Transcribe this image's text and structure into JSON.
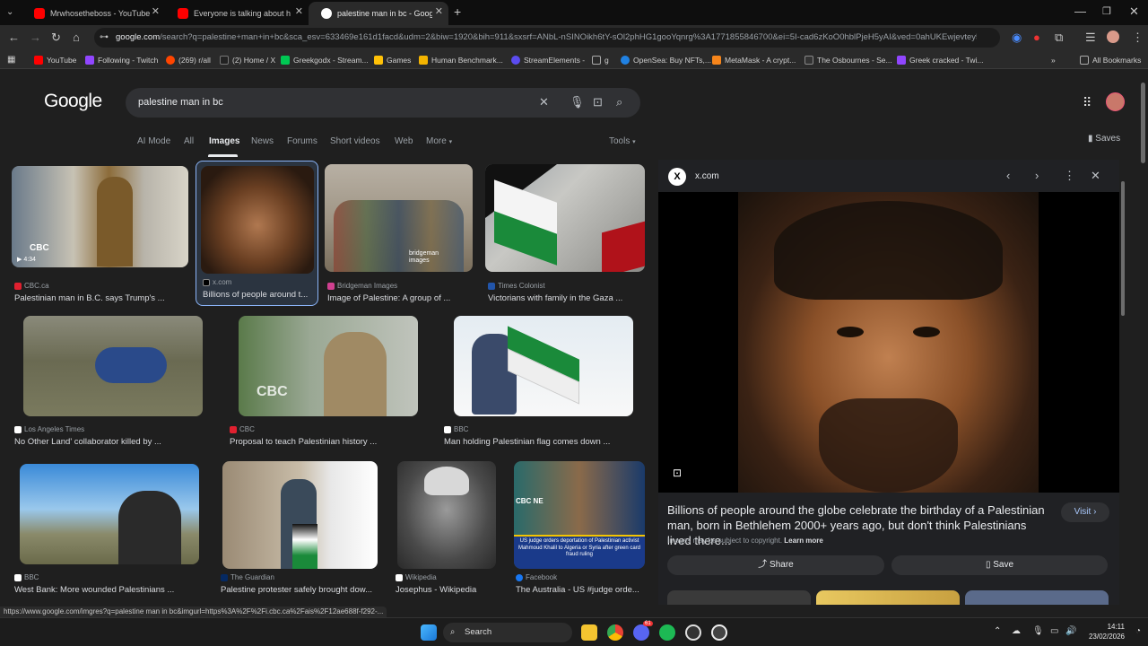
{
  "browser": {
    "tabs": [
      {
        "label": "Mrwhosetheboss - YouTube",
        "favicon": "youtube-icon",
        "color": "#ff0000"
      },
      {
        "label": "Everyone is talking about her.",
        "favicon": "youtube-icon",
        "color": "#ff0000"
      },
      {
        "label": "palestine man in bc - Google S",
        "favicon": "google-icon",
        "color": "#ffffff"
      }
    ],
    "new_tab": "+",
    "url_host": "google.com",
    "url_rest": "/search?q=palestine+man+in+bc&sca_esv=633469e161d1facd&udm=2&biw=1920&bih=911&sxsrf=ANbL-nSINOikh6tY-sOl2phHG1gooYqnrg%3A1771855846700&ei=5I-cad6zKoO0hblPjeH5yAI&ved=0ahUKEwjevtey5...",
    "bookmarks": [
      {
        "label": "YouTube",
        "color": "#ff0000"
      },
      {
        "label": "Following - Twitch",
        "color": "#9146ff"
      },
      {
        "label": "(269) r/all",
        "color": "#ff4500"
      },
      {
        "label": "(2) Home / X",
        "color": "#ffffff"
      },
      {
        "label": "Greekgodx - Stream...",
        "color": "#00c853"
      },
      {
        "label": "Games",
        "color": "#ffc107"
      },
      {
        "label": "Human Benchmark...",
        "color": "#f4b400"
      },
      {
        "label": "StreamElements -",
        "color": "#5b4cf0"
      },
      {
        "label": "g",
        "color": "#9aa0a6"
      },
      {
        "label": "OpenSea: Buy NFTs,...",
        "color": "#2081e2"
      },
      {
        "label": "MetaMask - A crypt...",
        "color": "#f6851b"
      },
      {
        "label": "The Osbournes - Se...",
        "color": "#333333"
      },
      {
        "label": "Greek cracked - Twi...",
        "color": "#9146ff"
      }
    ],
    "all_bookmarks": "All Bookmarks"
  },
  "google": {
    "logo": "Google",
    "query": "palestine man in bc",
    "nav_tabs": [
      "AI Mode",
      "All",
      "Images",
      "News",
      "Forums",
      "Short videos",
      "Web",
      "More"
    ],
    "tools": "Tools",
    "saves": "Saves"
  },
  "results": [
    {
      "source": "CBC.ca",
      "title": "Palestinian man in B.C. says Trump's ...",
      "icon_color": "#e0202f",
      "badge": "CBC",
      "duration": "4:34"
    },
    {
      "source": "x.com",
      "title": "Billions of people around t...",
      "icon_color": "#ffffff"
    },
    {
      "source": "Bridgeman Images",
      "title": "Image of Palestine: A group of ...",
      "icon_color": "#d04090",
      "watermark": "bridgeman images"
    },
    {
      "source": "Times Colonist",
      "title": "Victorians with family in the Gaza ...",
      "icon_color": "#2255aa"
    },
    {
      "source": "Los Angeles Times",
      "title": "No Other Land' collaborator killed by ...",
      "icon_color": "#ffffff"
    },
    {
      "source": "CBC",
      "title": "Proposal to teach Palestinian history ...",
      "icon_color": "#e0202f",
      "badge": "CBC"
    },
    {
      "source": "BBC",
      "title": "Man holding Palestinian flag comes down ...",
      "icon_color": "#ffffff"
    },
    {
      "source": "BBC",
      "title": "West Bank: More wounded Palestinians ...",
      "icon_color": "#ffffff"
    },
    {
      "source": "The Guardian",
      "title": "Palestine protester safely brought dow...",
      "icon_color": "#052962"
    },
    {
      "source": "Wikipedia",
      "title": "Josephus - Wikipedia",
      "icon_color": "#ffffff"
    },
    {
      "source": "Facebook",
      "title": "The Australia - US #judge orde...",
      "icon_color": "#1877f2",
      "caption": "US judge orders deportation of Palestinian activist Mahmoud Khalil to Algeria or Syria after green card fraud ruling",
      "badge": "CBC NE"
    }
  ],
  "panel": {
    "source": "x.com",
    "title": "Billions of people around the globe celebrate the birthday of a Palestinian man, born in Bethlehem 2000+ years ago, but don't think Palestinians lived there...",
    "visit": "Visit",
    "copyright": "Images may be subject to copyright.",
    "learn_more": "Learn more",
    "share": "Share",
    "save": "Save"
  },
  "status_url": "https://www.google.com/imgres?q=palestine man in bc&imgurl=https%3A%2F%2Fi.cbc.ca%2Fais%2F12ae688f-f292-...",
  "taskbar": {
    "search": "Search",
    "time": "14:11",
    "date": "23/02/2026",
    "discord_badge": "61"
  }
}
